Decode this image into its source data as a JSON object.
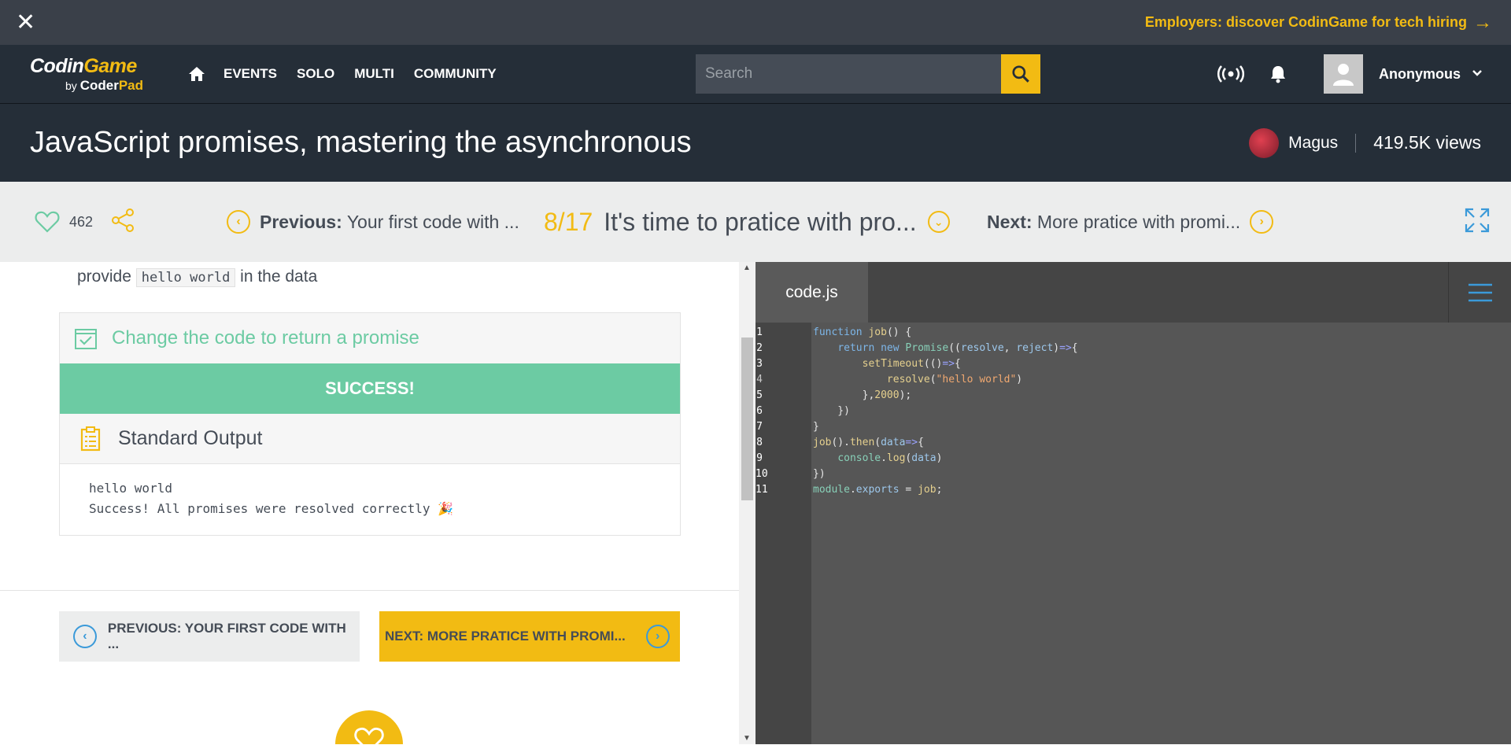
{
  "banner": {
    "close": "✕",
    "promo": "Employers: discover CodinGame for tech hiring",
    "promo_arrow": "→"
  },
  "logo": {
    "coding": "Codin",
    "game": "Game",
    "by": "by ",
    "coder": "Coder",
    "pad": "Pad"
  },
  "nav": {
    "items": [
      "EVENTS",
      "SOLO",
      "MULTI",
      "COMMUNITY"
    ],
    "user": "Anonymous"
  },
  "search": {
    "placeholder": "Search"
  },
  "page": {
    "title": "JavaScript promises, mastering the asynchronous",
    "author": "Magus",
    "views": "419.5K views"
  },
  "lesson": {
    "likes": "462",
    "prev_label": "Previous:",
    "prev_title": "Your first code with ...",
    "progress": "8/17",
    "current_title": "It's time to pratice with pro...",
    "next_label": "Next:",
    "next_title": "More pratice with promi..."
  },
  "content": {
    "fragment_prefix": "provide",
    "fragment_code": "hello world",
    "fragment_suffix": "in the data",
    "task": "Change the code to return a promise",
    "status": "SUCCESS!",
    "output_title": "Standard Output",
    "output_lines": [
      "hello world",
      "Success! All promises were resolved correctly 🎉"
    ],
    "prev_button": "PREVIOUS: YOUR FIRST CODE WITH ...",
    "next_button": "NEXT: MORE PRATICE WITH PROMI..."
  },
  "editor": {
    "file": "code.js",
    "line_numbers": [
      "1",
      "2",
      "3",
      "4",
      "5",
      "6",
      "7",
      "8",
      "9",
      "10",
      "11"
    ]
  },
  "colors": {
    "accent": "#f2bb13",
    "success": "#6ccba3",
    "dark": "#252e38",
    "link": "#3b9ad9"
  }
}
